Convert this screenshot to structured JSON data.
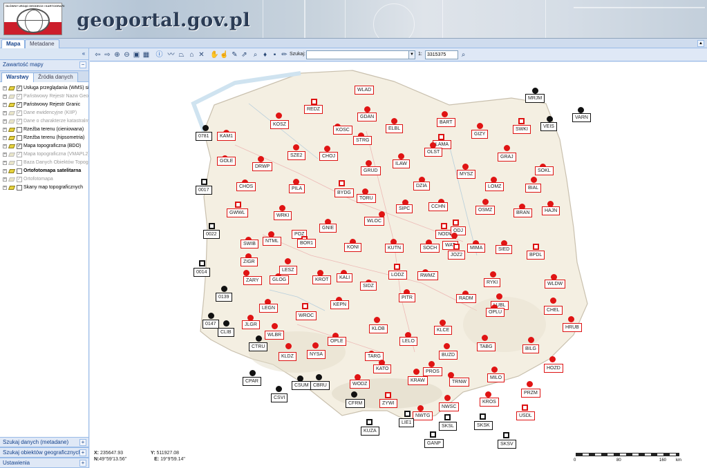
{
  "banner": {
    "logo_text": "GŁÓWNY URZĄD GEODEZJI I KARTOGRAFII",
    "site_title": "geoportal.gov.pl"
  },
  "top_tabs": [
    "Mapa",
    "Metadane"
  ],
  "left_panel": {
    "title": "Zawartość mapy",
    "tabs": [
      "Warstwy",
      "Źródła danych"
    ],
    "layers": [
      {
        "label": "Usługa przeglądania (WMS) sieci",
        "checked": true,
        "enabled": true,
        "bold": false
      },
      {
        "label": "Państwowy Rejestr Nazw Geo",
        "checked": true,
        "enabled": false,
        "bold": false
      },
      {
        "label": "Państwowy Rejestr Granic",
        "checked": true,
        "enabled": true,
        "bold": false
      },
      {
        "label": "Dane ewidencyjne (KIIP)",
        "checked": true,
        "enabled": false,
        "bold": false
      },
      {
        "label": "Dane o charakterze katastralnym",
        "checked": true,
        "enabled": false,
        "bold": false
      },
      {
        "label": "Rzeźba terenu (cieniowana)",
        "checked": false,
        "enabled": true,
        "bold": false
      },
      {
        "label": "Rzeźba terenu (hipsometria)",
        "checked": false,
        "enabled": true,
        "bold": false
      },
      {
        "label": "Mapa topograficzna (BDO)",
        "checked": true,
        "enabled": true,
        "bold": false
      },
      {
        "label": "Mapa topograficzna (VMAPL2)",
        "checked": true,
        "enabled": false,
        "bold": false
      },
      {
        "label": "Baza Danych Obiektów Topograficznych",
        "checked": false,
        "enabled": false,
        "bold": false
      },
      {
        "label": "Ortofotomapa satelitarna",
        "checked": false,
        "enabled": true,
        "bold": true
      },
      {
        "label": "Ortofotomapa",
        "checked": true,
        "enabled": false,
        "bold": false
      },
      {
        "label": "Skany map topograficznych",
        "checked": false,
        "enabled": true,
        "bold": false
      }
    ],
    "bottom_panels": [
      "Szukaj danych (metadane)",
      "Szukaj obiektów geograficznych",
      "Ustawienia"
    ]
  },
  "toolbar": {
    "search_label": "Szukaj:",
    "search_value": "",
    "scale_prefix": "1:",
    "scale_value": "3315375"
  },
  "status": {
    "x_label": "X:",
    "x_value": "235647.93",
    "y_label": "Y:",
    "y_value": "511927.08",
    "n_label": "N:",
    "n_value": "49°59'13.56\"",
    "e_label": "E:",
    "e_value": "19°9'59.14\""
  },
  "scale_bar": {
    "ticks": [
      "0",
      "80",
      "160"
    ],
    "unit": "km"
  },
  "colors": {
    "station_red": "#e01414",
    "station_black": "#111111",
    "panel_blue": "#dfe8f6",
    "border_blue": "#99bbe8"
  },
  "stations": [
    {
      "id": "WLAD",
      "type": "red-dot"
    },
    {
      "id": "REDZ",
      "type": "red-sq"
    },
    {
      "id": "MRJM",
      "type": "black-dot"
    },
    {
      "id": "VARN",
      "type": "black-dot"
    },
    {
      "id": "VEIS",
      "type": "black-dot"
    },
    {
      "id": "GDAN",
      "type": "red-dot"
    },
    {
      "id": "KOSZ",
      "type": "red-dot"
    },
    {
      "id": "KOSC",
      "type": "red-dot"
    },
    {
      "id": "ELBL",
      "type": "red-dot"
    },
    {
      "id": "BART",
      "type": "red-dot"
    },
    {
      "id": "SWKI",
      "type": "red-sq"
    },
    {
      "id": "0781",
      "type": "black-dot"
    },
    {
      "id": "KAM1",
      "type": "red-dot"
    },
    {
      "id": "STRG",
      "type": "red-dot"
    },
    {
      "id": "LAMA",
      "type": "red-sq"
    },
    {
      "id": "GIZY",
      "type": "red-dot"
    },
    {
      "id": "OLST",
      "type": "red-dot"
    },
    {
      "id": "SZE2",
      "type": "red-dot"
    },
    {
      "id": "CHOJ",
      "type": "red-dot"
    },
    {
      "id": "GRAJ",
      "type": "red-dot"
    },
    {
      "id": "GOLE",
      "type": "red-dot"
    },
    {
      "id": "DRWP",
      "type": "red-dot"
    },
    {
      "id": "ILAW",
      "type": "red-dot"
    },
    {
      "id": "GRUD",
      "type": "red-dot"
    },
    {
      "id": "SOKL",
      "type": "red-dot"
    },
    {
      "id": "MYSZ",
      "type": "red-dot"
    },
    {
      "id": "BIAL",
      "type": "red-dot"
    },
    {
      "id": "0017",
      "type": "black-sq"
    },
    {
      "id": "CHOS",
      "type": "red-dot"
    },
    {
      "id": "PILA",
      "type": "red-dot"
    },
    {
      "id": "BYDG",
      "type": "red-sq"
    },
    {
      "id": "DZIA",
      "type": "red-dot"
    },
    {
      "id": "LOMZ",
      "type": "red-dot"
    },
    {
      "id": "TORU",
      "type": "red-dot"
    },
    {
      "id": "GWWL",
      "type": "red-sq"
    },
    {
      "id": "WRKI",
      "type": "red-dot"
    },
    {
      "id": "SIPC",
      "type": "red-dot"
    },
    {
      "id": "CCHN",
      "type": "red-dot"
    },
    {
      "id": "OSMZ",
      "type": "red-dot"
    },
    {
      "id": "HAJN",
      "type": "red-dot"
    },
    {
      "id": "BRAN",
      "type": "red-dot"
    },
    {
      "id": "WLOC",
      "type": "red-dot"
    },
    {
      "id": "GNIE",
      "type": "red-dot"
    },
    {
      "id": "0022",
      "type": "black-sq"
    },
    {
      "id": "POZ",
      "type": "red-dot"
    },
    {
      "id": "NODW",
      "type": "red-sq"
    },
    {
      "id": "ODJ",
      "type": "red-sq"
    },
    {
      "id": "NTML",
      "type": "red-dot"
    },
    {
      "id": "BOR1",
      "type": "red-sq"
    },
    {
      "id": "SWIB",
      "type": "red-dot"
    },
    {
      "id": "KONI",
      "type": "red-dot"
    },
    {
      "id": "KUTN",
      "type": "red-dot"
    },
    {
      "id": "SOCH",
      "type": "red-dot"
    },
    {
      "id": "WAT",
      "type": "red-dot"
    },
    {
      "id": "MIMA",
      "type": "red-dot"
    },
    {
      "id": "SIED",
      "type": "red-dot"
    },
    {
      "id": "JOZ2",
      "type": "red-sq"
    },
    {
      "id": "BPDL",
      "type": "red-sq"
    },
    {
      "id": "ZIGR",
      "type": "red-dot"
    },
    {
      "id": "0014",
      "type": "black-sq"
    },
    {
      "id": "LESZ",
      "type": "red-dot"
    },
    {
      "id": "ZARY",
      "type": "red-dot"
    },
    {
      "id": "GLOG",
      "type": "red-dot"
    },
    {
      "id": "KROT",
      "type": "red-dot"
    },
    {
      "id": "KALI",
      "type": "red-dot"
    },
    {
      "id": "LODZ",
      "type": "red-sq"
    },
    {
      "id": "RWMZ",
      "type": "red-dot"
    },
    {
      "id": "RYKI",
      "type": "red-dot"
    },
    {
      "id": "WLDW",
      "type": "red-dot"
    },
    {
      "id": "0139",
      "type": "black-dot"
    },
    {
      "id": "SIDZ",
      "type": "red-dot"
    },
    {
      "id": "PITR",
      "type": "red-dot"
    },
    {
      "id": "RADM",
      "type": "red-dot"
    },
    {
      "id": "LUBL",
      "type": "red-dot"
    },
    {
      "id": "LEGN",
      "type": "red-dot"
    },
    {
      "id": "KEPN",
      "type": "red-dot"
    },
    {
      "id": "CHEL",
      "type": "red-dot"
    },
    {
      "id": "WROC",
      "type": "red-sq"
    },
    {
      "id": "OPLU",
      "type": "red-dot"
    },
    {
      "id": "0147",
      "type": "black-dot"
    },
    {
      "id": "JLGR",
      "type": "red-dot"
    },
    {
      "id": "HRUB",
      "type": "red-dot"
    },
    {
      "id": "CLIB",
      "type": "black-dot"
    },
    {
      "id": "KLOB",
      "type": "red-dot"
    },
    {
      "id": "KLCE",
      "type": "red-dot"
    },
    {
      "id": "WLBR",
      "type": "red-dot"
    },
    {
      "id": "CTRU",
      "type": "black-dot"
    },
    {
      "id": "LELO",
      "type": "red-dot"
    },
    {
      "id": "OPLE",
      "type": "red-dot"
    },
    {
      "id": "TABG",
      "type": "red-dot"
    },
    {
      "id": "BILG",
      "type": "red-dot"
    },
    {
      "id": "KLDZ",
      "type": "red-dot"
    },
    {
      "id": "NYSA",
      "type": "red-dot"
    },
    {
      "id": "TARG",
      "type": "red-dot"
    },
    {
      "id": "BUZD",
      "type": "red-dot"
    },
    {
      "id": "HOZD",
      "type": "red-dot"
    },
    {
      "id": "KATO",
      "type": "red-dot"
    },
    {
      "id": "PROS",
      "type": "red-dot"
    },
    {
      "id": "CPAR",
      "type": "black-dot"
    },
    {
      "id": "CSUM",
      "type": "black-dot"
    },
    {
      "id": "CBRU",
      "type": "black-dot"
    },
    {
      "id": "KRAW",
      "type": "red-dot"
    },
    {
      "id": "TRNW",
      "type": "red-dot"
    },
    {
      "id": "MILO",
      "type": "red-dot"
    },
    {
      "id": "WODZ",
      "type": "red-dot"
    },
    {
      "id": "PRZM",
      "type": "red-dot"
    },
    {
      "id": "CSVI",
      "type": "black-dot"
    },
    {
      "id": "CFRM",
      "type": "black-dot"
    },
    {
      "id": "ZYWI",
      "type": "red-sq"
    },
    {
      "id": "KROS",
      "type": "red-dot"
    },
    {
      "id": "NWSC",
      "type": "red-dot"
    },
    {
      "id": "USDL",
      "type": "red-sq"
    },
    {
      "id": "NWTG",
      "type": "red-dot"
    },
    {
      "id": "LIE1",
      "type": "black-sq"
    },
    {
      "id": "SKSL",
      "type": "black-sq"
    },
    {
      "id": "SKSK",
      "type": "black-sq"
    },
    {
      "id": "KUZA",
      "type": "black-sq"
    },
    {
      "id": "GANP",
      "type": "black-sq"
    },
    {
      "id": "SKSV",
      "type": "black-sq"
    }
  ]
}
